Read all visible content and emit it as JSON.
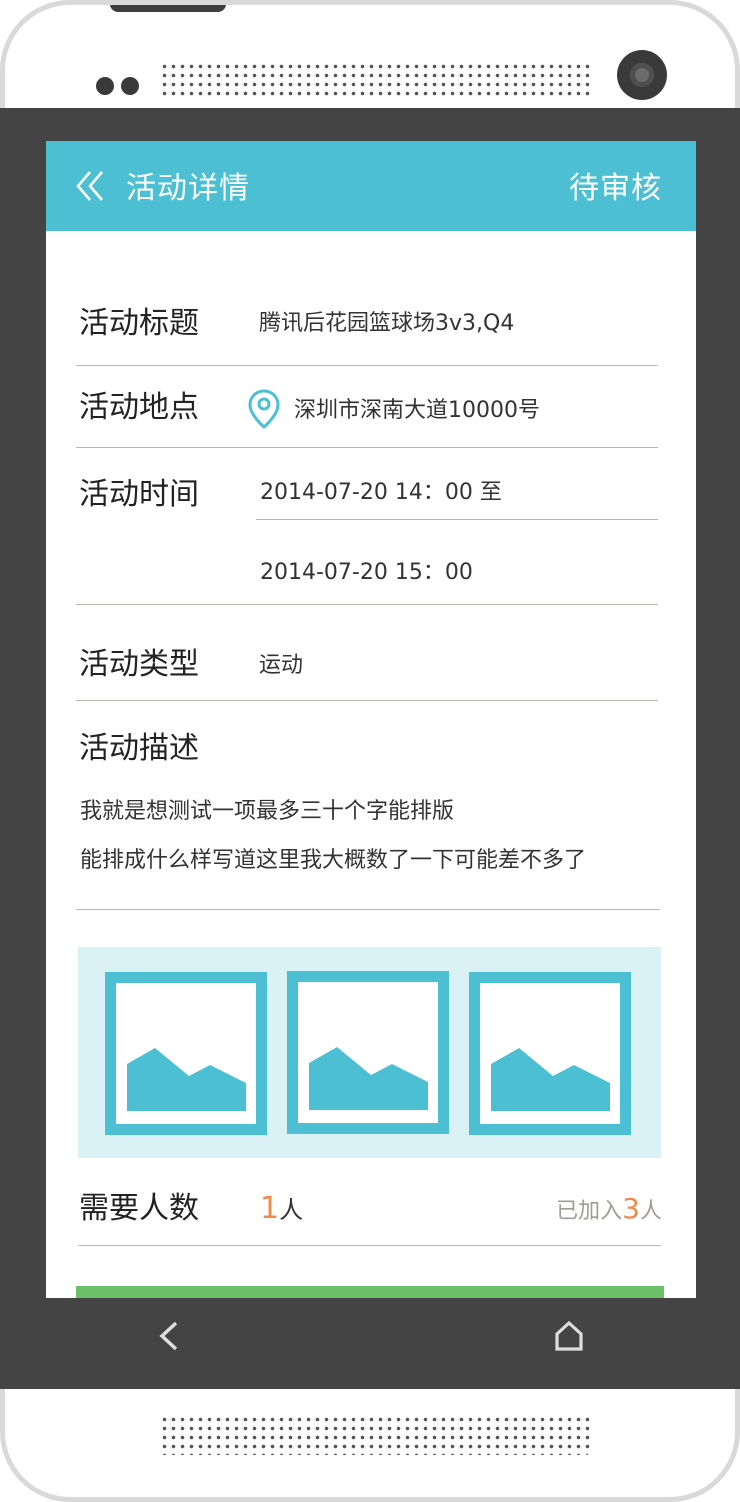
{
  "header": {
    "title": "活动详情",
    "status": "待审核"
  },
  "fields": {
    "title_label": "活动标题",
    "title_value": "腾讯后花园篮球场3v3,Q4",
    "location_label": "活动地点",
    "location_value": "深圳市深南大道10000号",
    "time_label": "活动时间",
    "time_start": "2014-07-20 14：00 至",
    "time_end": "2014-07-20 15：00",
    "type_label": "活动类型",
    "type_value": "运动",
    "desc_label": "活动描述",
    "desc_line1": "我就是想测试一项最多三十个字能排版",
    "desc_line2": "能排成什么样写道这里我大概数了一下可能差不多了"
  },
  "people": {
    "label": "需要人数",
    "needed": "1",
    "unit": "人",
    "joined_prefix": "已加入",
    "joined_count": "3",
    "joined_unit": "人"
  },
  "gallery": {
    "count": 3,
    "icon": "image-placeholder-icon"
  },
  "colors": {
    "accent": "#4cc0d2",
    "highlight": "#f08a4b",
    "action": "#6cc067",
    "bezel": "#444444"
  },
  "icons": [
    "double-chevron-left-icon",
    "location-pin-icon",
    "image-placeholder-icon",
    "nav-back-icon",
    "nav-home-icon"
  ]
}
